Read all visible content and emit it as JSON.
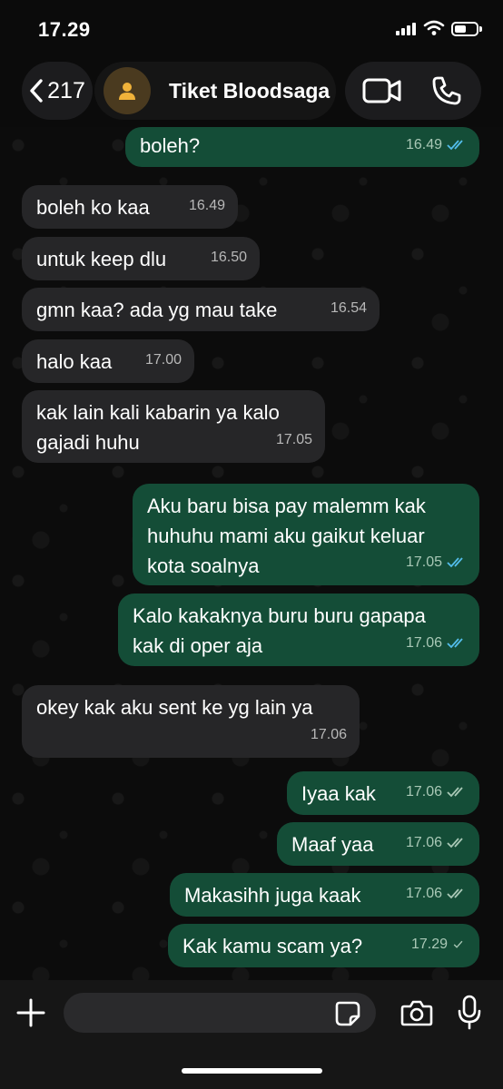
{
  "status_bar": {
    "time": "17.29"
  },
  "header": {
    "back_count": "217",
    "contact_name": "Tiket Bloodsaga"
  },
  "messages": [
    {
      "direction": "out",
      "text": "boleh?",
      "time": "16.49",
      "status": "read"
    },
    {
      "direction": "in",
      "text": "boleh ko kaa",
      "time": "16.49"
    },
    {
      "direction": "in",
      "text": "untuk keep dlu",
      "time": "16.50"
    },
    {
      "direction": "in",
      "text": "gmn kaa? ada yg mau take",
      "time": "16.54"
    },
    {
      "direction": "in",
      "text": "halo kaa",
      "time": "17.00"
    },
    {
      "direction": "in",
      "lines": [
        "kak lain kali kabarin ya kalo",
        "gajadi huhu"
      ],
      "time": "17.05"
    },
    {
      "direction": "out",
      "lines": [
        "Aku baru bisa pay malemm kak",
        "huhuhu mami aku gaikut keluar",
        "kota soalnya"
      ],
      "time": "17.05",
      "status": "read"
    },
    {
      "direction": "out",
      "lines": [
        "Kalo kakaknya buru buru gapapa",
        "kak di oper aja"
      ],
      "time": "17.06",
      "status": "read"
    },
    {
      "direction": "in",
      "text": "okey kak aku sent ke yg lain ya",
      "time": "17.06"
    },
    {
      "direction": "out",
      "text": "Iyaa kak",
      "time": "17.06",
      "status": "delivered"
    },
    {
      "direction": "out",
      "text": "Maaf yaa",
      "time": "17.06",
      "status": "delivered"
    },
    {
      "direction": "out",
      "text": "Makasihh juga kaak",
      "time": "17.06",
      "status": "delivered"
    },
    {
      "direction": "out",
      "text": "Kak kamu scam ya?",
      "time": "17.29",
      "status": "sent"
    }
  ],
  "colors": {
    "incoming_bubble": "#262628",
    "outgoing_bubble": "#144d37",
    "read_tick": "#53bdeb",
    "unread_tick": "#a9c8b6"
  },
  "icons": {
    "back": "chevron-left-icon",
    "avatar": "person-icon",
    "video": "video-camera-icon",
    "phone": "phone-icon",
    "plus": "plus-icon",
    "sticker": "sticker-icon",
    "camera": "camera-icon",
    "mic": "microphone-icon"
  }
}
